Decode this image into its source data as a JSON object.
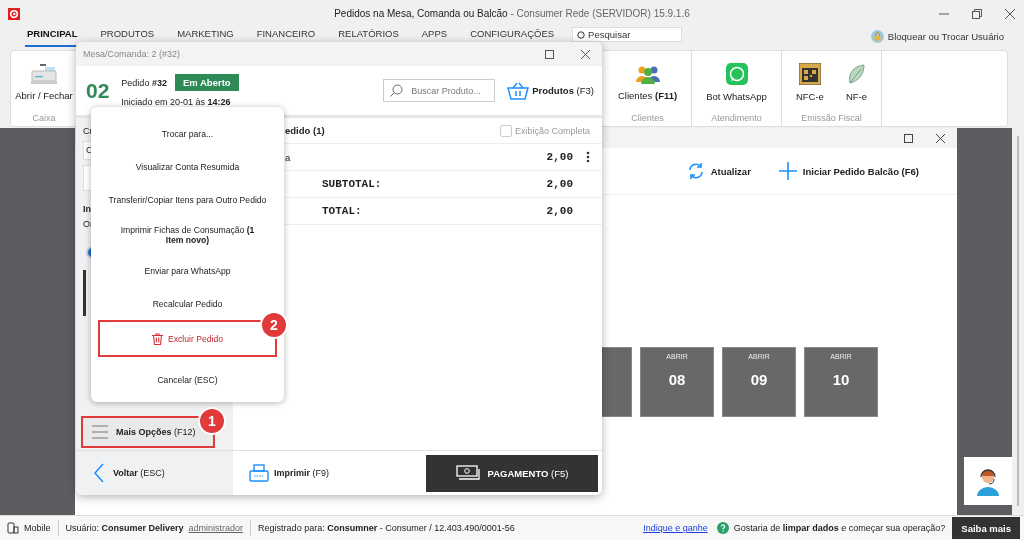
{
  "window": {
    "title": "Pedidos na Mesa, Comanda ou Balcão",
    "subtitle": "- Consumer Rede (SERVIDOR) 15.9.1.6"
  },
  "menu_tabs": [
    {
      "label": "PRINCIPAL",
      "selected": true
    },
    {
      "label": "PRODUTOS",
      "selected": false
    },
    {
      "label": "MARKETING",
      "selected": false
    },
    {
      "label": "FINANCEIRO",
      "selected": false
    },
    {
      "label": "RELATÓRIOS",
      "selected": false
    },
    {
      "label": "APPS",
      "selected": false
    },
    {
      "label": "CONFIGURAÇÕES",
      "selected": false
    }
  ],
  "search": {
    "placeholder": "Pesquisar"
  },
  "lock_user": "Bloquear ou Trocar Usuário",
  "ribbon": [
    {
      "label": "Caixa",
      "buttons": [
        {
          "kind": "register",
          "label": "Abrir / Fechar"
        }
      ]
    },
    {
      "label": "Clientes",
      "buttons": [
        {
          "kind": "people",
          "label": "Clientes **(F11)**"
        }
      ]
    },
    {
      "label": "Atendimento",
      "buttons": [
        {
          "kind": "chat",
          "label": "Bot WhatsApp"
        }
      ]
    },
    {
      "label": "Emissão Fiscal",
      "buttons": [
        {
          "kind": "qr",
          "label": "NFC-e"
        },
        {
          "kind": "leaf",
          "label": "NF-e"
        }
      ]
    }
  ],
  "tables_window": {
    "actions": [
      {
        "kind": "refresh",
        "label": "Atualizar"
      },
      {
        "kind": "add",
        "label": "Iniciar Pedido Balcão (F6)"
      }
    ],
    "tables": [
      {
        "kind": "covered"
      },
      {
        "kind": "table",
        "status": "ABRIR",
        "number": "08"
      },
      {
        "kind": "table",
        "status": "ABRIR",
        "number": "09"
      },
      {
        "kind": "table",
        "status": "ABRIR",
        "number": "10"
      }
    ]
  },
  "order_dialog": {
    "title": "Mesa/Comanda: 2 (#32)",
    "table_number": "02",
    "order": "Pedido **#32**",
    "status": "Em Aberto",
    "started": "Iniciado em 20-01 às **14:26**",
    "search": {
      "placeholder": "Buscar Produto..."
    },
    "products_button": "**Produtos** (F3)",
    "left_panel": [
      {
        "kind": "text",
        "text": "Cr"
      },
      {
        "kind": "field",
        "value": "C"
      },
      {
        "kind": "field"
      },
      {
        "kind": "heading",
        "text": "In"
      },
      {
        "kind": "text",
        "text": "Or"
      },
      {
        "kind": "radio",
        "selected": true
      },
      {
        "kind": "bar"
      }
    ],
    "more_button": {
      "label": "**Mais Opções** (F12)",
      "highlighted": true,
      "step_badge": "1"
    },
    "back_button": "**Voltar** (ESC)",
    "items_header": "edido (1)",
    "full_view": {
      "label": "Exibição Completa",
      "checked": false
    },
    "items": [
      {
        "name": "a",
        "value": "2,00"
      }
    ],
    "totals": [
      {
        "label": "SUBTOTAL:",
        "value": "2,00"
      },
      {
        "label": "TOTAL:",
        "value": "2,00"
      }
    ],
    "print_button": "**Imprimir** (F9)",
    "pay_button": "**PAGAMENTO** (F5)",
    "menu": [
      {
        "kind": "plain",
        "label": "Trocar para...",
        "highlighted": false
      },
      {
        "kind": "plain",
        "label": "Visualizar Conta Resumida",
        "highlighted": false
      },
      {
        "kind": "plain",
        "label": "Transferir/Copiar Itens para Outro Pedido",
        "highlighted": false
      },
      {
        "kind": "plain",
        "label": "Imprimir Fichas de Consumação **(1 Item novo)**",
        "highlighted": false
      },
      {
        "kind": "plain",
        "label": "Enviar para WhatsApp",
        "highlighted": false
      },
      {
        "kind": "plain",
        "label": "Recalcular Pedido",
        "highlighted": false
      },
      {
        "kind": "delete",
        "label": "Excluir Pedido",
        "highlighted": true,
        "step_badge": "2"
      },
      {
        "kind": "plain",
        "label": "Cancelar (ESC)",
        "highlighted": false
      }
    ]
  },
  "status_bar": {
    "device": "Mobile",
    "user": "Usuário: **Consumer Delivery**",
    "role": "administrador",
    "registered": "Registrado para: **Consumner** - Consumer / 12.403.490/0001-56",
    "referral_link": "Indique e ganhe",
    "prompt": "Gostaria de **limpar dados** e começar sua operação?",
    "learn_more": "Saiba mais"
  }
}
